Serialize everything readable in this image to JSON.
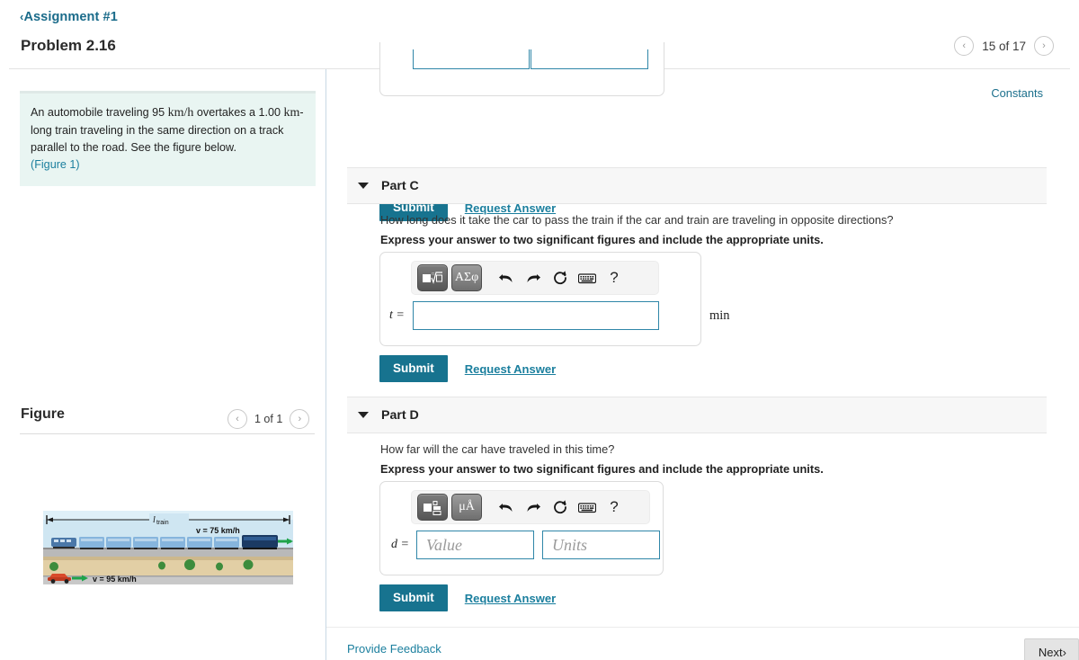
{
  "header": {
    "back_chevron": "‹",
    "back_label": "Assignment #1",
    "title": "Problem 2.16",
    "pager": {
      "prev_icon": "‹",
      "next_icon": "›",
      "label": "15 of 17"
    }
  },
  "sidebar": {
    "problem": {
      "line1_a": "An automobile traveling 95",
      "line1_unit1": "km/h",
      "line1_b": "overtakes a 1.00",
      "line1_unit2": "km",
      "line1_c": "-",
      "line2": "long train traveling in the same direction on a track parallel",
      "line3": "to the road. See the figure below.",
      "figure_link": "(Figure 1)",
      "background": "#e9f5f2"
    },
    "figure": {
      "heading": "Figure",
      "pager": {
        "prev_icon": "‹",
        "next_icon": "›",
        "label": "1 of 1"
      },
      "labels": {
        "length": "l",
        "length_sub": "train",
        "train_speed": "v = 75 km/h",
        "car_speed": "v = 95 km/h"
      },
      "colors": {
        "sky": "#cfe6f2",
        "train_car": "#86b5dd",
        "locomotive": "#1b3a63",
        "ground": "#e2cfa5",
        "ballast": "#b9b9b9",
        "road": "#c8c8c8",
        "car": "#d94a2b",
        "arrow": "#1fa34a",
        "tree": "#3d8c3d"
      }
    }
  },
  "main": {
    "constants_link": "Constants",
    "top_partial": {
      "submit_label": "Submit",
      "request_label": "Request Answer"
    },
    "parts": [
      {
        "id": "part-c",
        "caret": "▾",
        "label": "Part C",
        "question": "How long does it take the car to pass the train if the car and train are traveling in opposite directions?",
        "instruction": "Express your answer to two significant figures and include the appropriate units.",
        "toolbar": {
          "math_palette_icon": "square-root-template-icon",
          "greek_button_label": "ΑΣφ",
          "undo_icon": "undo-icon",
          "redo_icon": "redo-icon",
          "reset_icon": "reset-icon",
          "keyboard_icon": "keyboard-icon",
          "help_icon": "?"
        },
        "variable": "t =",
        "input_value": "",
        "input_placeholder": "",
        "unit_label": "min",
        "submit_label": "Submit",
        "request_label": "Request Answer"
      },
      {
        "id": "part-d",
        "caret": "▾",
        "label": "Part D",
        "question": "How far will the car have traveled in this time?",
        "instruction": "Express your answer to two significant figures and include the appropriate units.",
        "toolbar": {
          "math_palette_icon": "template-blocks-icon",
          "greek_button_label": "μÅ",
          "undo_icon": "undo-icon",
          "redo_icon": "redo-icon",
          "reset_icon": "reset-icon",
          "keyboard_icon": "keyboard-icon",
          "help_icon": "?"
        },
        "variable": "d =",
        "value_input_value": "",
        "value_placeholder": "Value",
        "units_input_value": "",
        "units_placeholder": "Units",
        "submit_label": "Submit",
        "request_label": "Request Answer"
      }
    ]
  },
  "footer": {
    "feedback_label": "Provide Feedback",
    "next_label": "Next",
    "next_chevron": "›"
  },
  "theme": {
    "link": "#1b7f9e",
    "submit_bg": "#17738f",
    "input_border": "#2f86a8",
    "band_bg": "#f7f7f7"
  }
}
